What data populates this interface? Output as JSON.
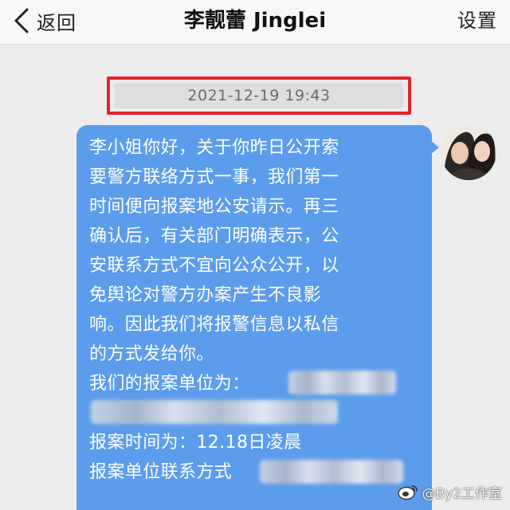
{
  "nav": {
    "back_label": "返回",
    "title": "李靓蕾 Jinglei",
    "settings_label": "设置"
  },
  "chat": {
    "timestamp": "2021-12-19 19:43",
    "message_lines": [
      "李小姐你好，关于你昨日公开索",
      "要警方联络方式一事，我们第一",
      "时间便向报案地公安请示。再三",
      "确认后，有关部门明确表示，公",
      "安联系方式不宜向公众公开，以",
      "免舆论对警方办案产生不良影",
      "响。因此我们将报警信息以私信",
      "的方式发给你。",
      "我们的报案单位为：",
      "",
      "报案时间为：12.18日凌晨",
      "报案单位联系方式"
    ]
  },
  "watermark": {
    "text": "@By2工作室"
  },
  "colors": {
    "bubble": "#5b9cec",
    "highlight_box": "#e0242a",
    "background": "#ececec",
    "navbar": "#f7f7f7"
  },
  "icons": {
    "back": "chevron-left-icon",
    "watermark": "weibo-icon"
  }
}
